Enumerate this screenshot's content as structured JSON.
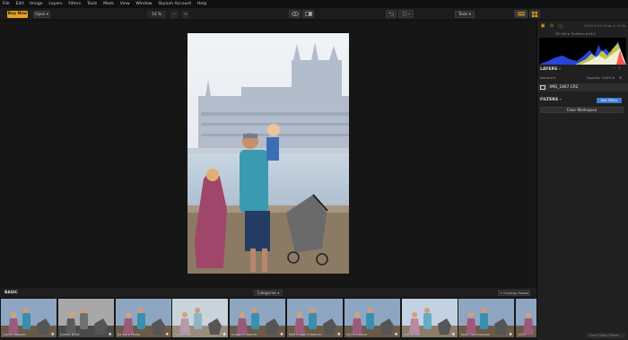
{
  "menu": [
    "File",
    "Edit",
    "Image",
    "Layers",
    "Filters",
    "Tools",
    "Mask",
    "View",
    "Window",
    "Skylum Account",
    "Help"
  ],
  "toolbar": {
    "buy_now": "Buy Now",
    "open": "Open ▾",
    "zoom": "14 %",
    "zoom_minus": "−",
    "zoom_plus": "+",
    "tools": "Tools ▾"
  },
  "panel": {
    "date": "04/04 ⊕ 11:24 am ⊕ 10:04",
    "meta": "ISO 100 ⊕ 70.00mm ⊕ f/4.0",
    "layers_title": "LAYERS -",
    "blend_mode": "Normal ▾",
    "opacity": "Opacity: 100% ▾",
    "layer_name": "IMG_1467.CR2",
    "filters_title": "FILTERS -",
    "add_filters": "Add Filters",
    "clear_workspace": "Clear Workspace",
    "save_preset": "Save Filters Preset..."
  },
  "presets_bar": {
    "section": "BASIC",
    "categories": "Categories ▾",
    "overlay": "+ Overlay Preset"
  },
  "presets": [
    {
      "label": "Clarity Booster",
      "tone": "color"
    },
    {
      "label": "Classic B&W",
      "tone": "bw"
    },
    {
      "label": "Da Daro Photo",
      "tone": "color"
    },
    {
      "label": "Foggy Day",
      "tone": "fog"
    },
    {
      "label": "Image Enhancer",
      "tone": "color"
    },
    {
      "label": "Mild Image Enhancer",
      "tone": "color"
    },
    {
      "label": "Sky Enhancer",
      "tone": "color"
    },
    {
      "label": "Soft & Airy",
      "tone": "soft"
    },
    {
      "label": "Tonal Compression",
      "tone": "color"
    },
    {
      "label": "Vivid",
      "tone": "color"
    }
  ],
  "colors": {
    "accent": "#e9a11f",
    "blue_button": "#3b7ed6"
  }
}
